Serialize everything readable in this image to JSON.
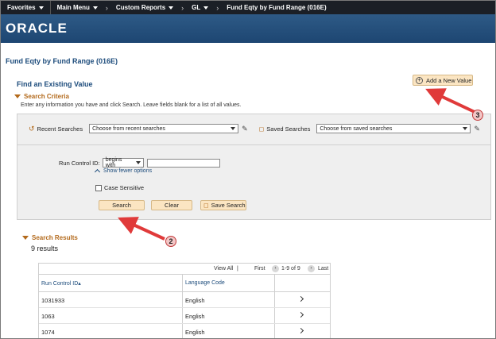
{
  "topnav": {
    "items": [
      {
        "label": "Favorites"
      },
      {
        "label": "Main Menu"
      },
      {
        "label": "Custom Reports"
      },
      {
        "label": "GL"
      }
    ],
    "current": "Fund Eqty by Fund Range (016E)"
  },
  "brand": {
    "logo_text": "ORACLE"
  },
  "page": {
    "title": "Fund Eqty by Fund Range (016E)",
    "find_title": "Find an Existing Value",
    "add_button": "Add a New Value"
  },
  "criteria": {
    "header": "Search Criteria",
    "instructions": "Enter any information you have and click Search. Leave fields blank for a list of all values.",
    "recent_label": "Recent Searches",
    "recent_value": "Choose from recent searches",
    "saved_label": "Saved Searches",
    "saved_value": "Choose from saved searches",
    "run_control_label": "Run Control ID:",
    "operator": "begins with",
    "run_control_value": "",
    "fewer_options": "Show fewer options",
    "case_sensitive": "Case Sensitive",
    "search_button": "Search",
    "clear_button": "Clear",
    "save_search_button": "Save Search"
  },
  "results": {
    "header": "Search Results",
    "count": "9 results",
    "toolbar": {
      "view_all": "View All",
      "first": "First",
      "range": "1-9 of 9",
      "last": "Last"
    },
    "columns": [
      "Run Control ID",
      "Language Code"
    ],
    "rows": [
      [
        "1031933",
        "English"
      ],
      [
        "1063",
        "English"
      ],
      [
        "1074",
        "English"
      ]
    ]
  },
  "callouts": {
    "one": "2",
    "two": "3"
  },
  "colors": {
    "accent": "#b36a1c",
    "nav": "#1b1f26",
    "brand": "#2a5682",
    "button": "#fbe5c2",
    "arrow": "#e03a3a"
  }
}
